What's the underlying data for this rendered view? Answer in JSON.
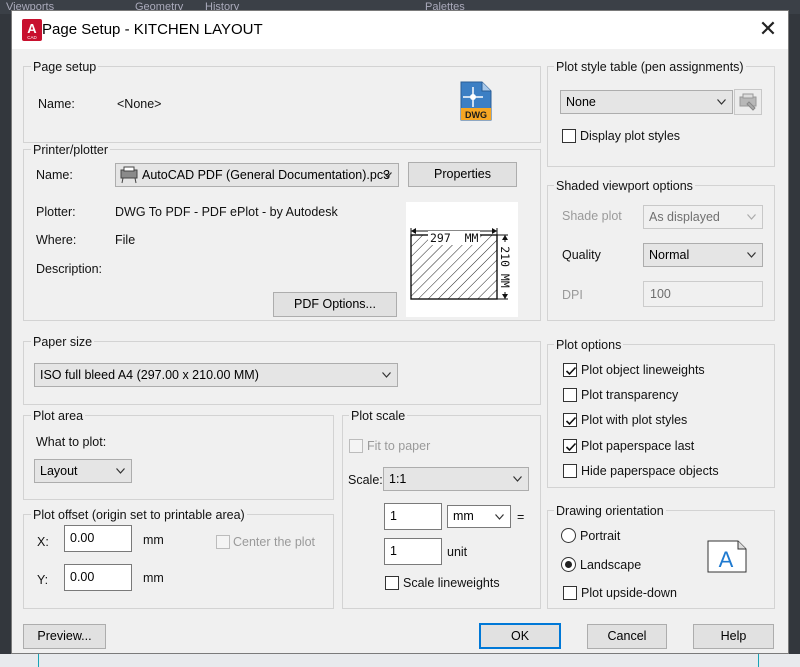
{
  "background": {
    "ribbon_tabs": [
      "Viewports",
      "Geometry",
      "History",
      "Palettes"
    ]
  },
  "window": {
    "title": "Page Setup - KITCHEN LAYOUT",
    "app_icon_letter": "A",
    "app_icon_sub": "CAD",
    "close_glyph": "✕"
  },
  "page_setup": {
    "group_label": "Page setup",
    "name_label": "Name:",
    "name_value": "<None>",
    "file_icon_text": "DWG"
  },
  "printer": {
    "group_label": "Printer/plotter",
    "name_label": "Name:",
    "name_value": "AutoCAD PDF (General Documentation).pc3",
    "properties_button": "Properties",
    "plotter_label": "Plotter:",
    "plotter_value": "DWG To PDF - PDF ePlot - by Autodesk",
    "where_label": "Where:",
    "where_value": "File",
    "description_label": "Description:",
    "pdf_options_button": "PDF Options...",
    "preview_width_text": "297  MM",
    "preview_height_text": "210 MM"
  },
  "paper_size": {
    "group_label": "Paper size",
    "value": "ISO full bleed A4 (297.00 x 210.00 MM)"
  },
  "plot_area": {
    "group_label": "Plot area",
    "what_label": "What to plot:",
    "value": "Layout"
  },
  "plot_offset": {
    "group_label": "Plot offset (origin set to printable area)",
    "x_label": "X:",
    "x_value": "0.00",
    "x_unit": "mm",
    "y_label": "Y:",
    "y_value": "0.00",
    "y_unit": "mm",
    "center_label": "Center the plot",
    "center_checked": false
  },
  "plot_scale": {
    "group_label": "Plot scale",
    "fit_label": "Fit to paper",
    "fit_checked": false,
    "scale_label": "Scale:",
    "scale_value": "1:1",
    "num_value": "1",
    "num_unit": "mm",
    "equals": "=",
    "den_value": "1",
    "den_unit": "unit",
    "lineweights_label": "Scale lineweights",
    "lineweights_checked": false
  },
  "plot_style": {
    "group_label": "Plot style table (pen assignments)",
    "value": "None",
    "display_label": "Display plot styles",
    "display_checked": false
  },
  "shaded": {
    "group_label": "Shaded viewport options",
    "shade_label": "Shade plot",
    "shade_value": "As displayed",
    "quality_label": "Quality",
    "quality_value": "Normal",
    "dpi_label": "DPI",
    "dpi_value": "100"
  },
  "plot_options": {
    "group_label": "Plot options",
    "items": [
      {
        "label": "Plot object lineweights",
        "checked": true
      },
      {
        "label": "Plot transparency",
        "checked": false
      },
      {
        "label": "Plot with plot styles",
        "checked": true
      },
      {
        "label": "Plot paperspace last",
        "checked": true
      },
      {
        "label": "Hide paperspace objects",
        "checked": false
      }
    ]
  },
  "orientation": {
    "group_label": "Drawing orientation",
    "portrait_label": "Portrait",
    "landscape_label": "Landscape",
    "selected": "Landscape",
    "upside_label": "Plot upside-down",
    "upside_checked": false,
    "icon_letter": "A"
  },
  "footer": {
    "preview_button": "Preview...",
    "ok_button": "OK",
    "cancel_button": "Cancel",
    "help_button": "Help"
  }
}
